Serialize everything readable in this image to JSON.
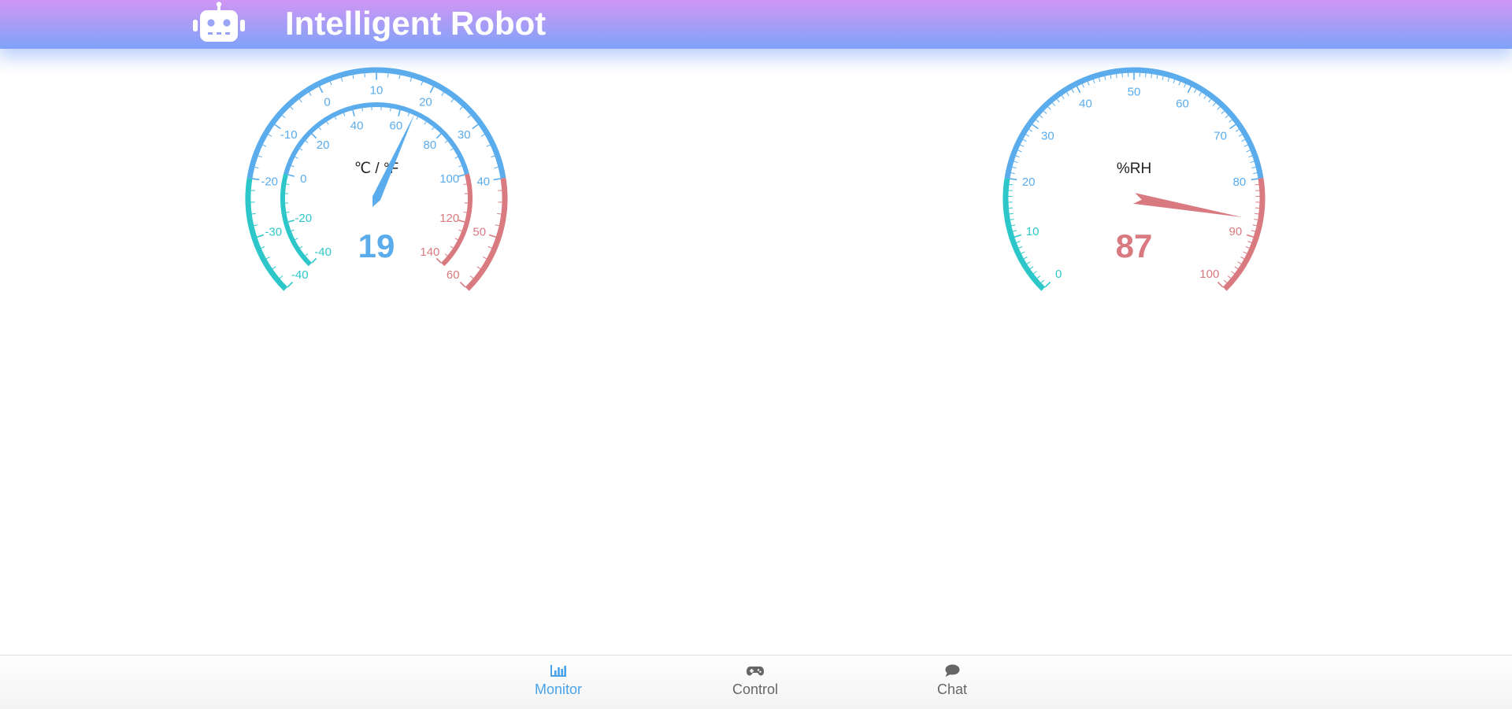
{
  "header": {
    "title": "Intelligent Robot",
    "logo_icon": "robot-icon",
    "gradient_top": "#d096f4",
    "gradient_bottom": "#7ea3f8"
  },
  "colors": {
    "normal": "#5aacec",
    "low": "#2ec7c9",
    "high": "#d87a80",
    "unit_text": "#222222"
  },
  "gauges": {
    "temperature": {
      "unit_label": "℃ / °F",
      "value": 19,
      "value_text": "19",
      "celsius": {
        "min": -40,
        "max": 60,
        "labels": [
          "-40",
          "-30",
          "-20",
          "-10",
          "0",
          "10",
          "20",
          "30",
          "40",
          "50",
          "60"
        ],
        "low_below": -20,
        "high_above": 40
      },
      "fahrenheit": {
        "min": -40,
        "max": 140,
        "labels": [
          "-40",
          "-20",
          "0",
          "20",
          "40",
          "60",
          "80",
          "100",
          "120",
          "140"
        ],
        "low_below": 0,
        "high_above": 100
      }
    },
    "humidity": {
      "unit_label": "%RH",
      "value": 87,
      "value_text": "87",
      "min": 0,
      "max": 100,
      "labels": [
        "0",
        "10",
        "20",
        "30",
        "40",
        "50",
        "60",
        "70",
        "80",
        "90",
        "100"
      ],
      "low_below": 20,
      "high_above": 80
    }
  },
  "nav": {
    "items": [
      {
        "label": "Monitor",
        "icon": "bar-chart-icon",
        "active": true
      },
      {
        "label": "Control",
        "icon": "gamepad-icon",
        "active": false
      },
      {
        "label": "Chat",
        "icon": "chat-bubble-icon",
        "active": false
      }
    ],
    "active_color": "#4aa3e8",
    "inactive_color": "#666666"
  }
}
